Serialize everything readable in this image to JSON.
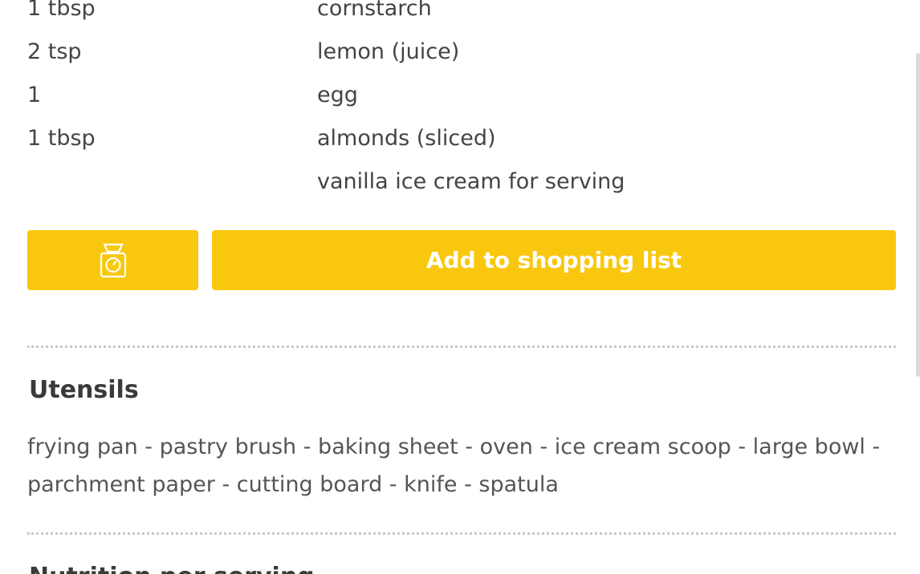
{
  "ingredients": [
    {
      "amount": "1 tbsp",
      "name": "cornstarch"
    },
    {
      "amount": "2 tsp",
      "name": "lemon (juice)"
    },
    {
      "amount": "1",
      "name": "egg"
    },
    {
      "amount": "1 tbsp",
      "name": "almonds (sliced)"
    },
    {
      "amount": "",
      "name": "vanilla ice cream for serving"
    }
  ],
  "actions": {
    "scale_icon": "kitchen-scale-icon",
    "add_to_list_label": "Add to shopping list"
  },
  "utensils": {
    "title": "Utensils",
    "list": "frying pan - pastry brush - baking sheet - oven - ice cream scoop - large bowl - parchment paper - cutting board - knife - spatula"
  },
  "next_section": {
    "title": "Nutrition per serving"
  },
  "colors": {
    "accent": "#f9c80e",
    "text": "#444444"
  }
}
